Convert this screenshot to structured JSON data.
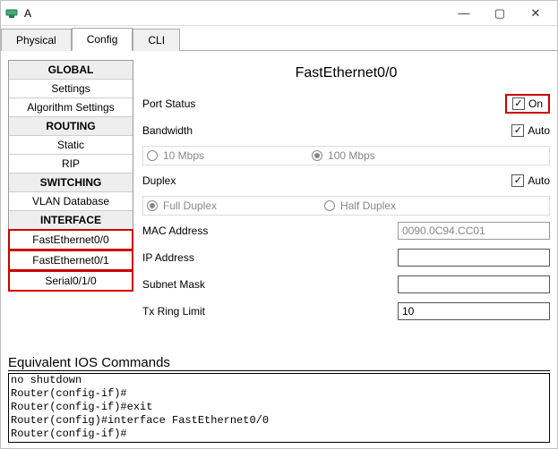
{
  "window": {
    "title": "A"
  },
  "tabs": {
    "physical": "Physical",
    "config": "Config",
    "cli": "CLI"
  },
  "sidebar": {
    "global_hdr": "GLOBAL",
    "settings": "Settings",
    "algo": "Algorithm Settings",
    "routing_hdr": "ROUTING",
    "static": "Static",
    "rip": "RIP",
    "switching_hdr": "SWITCHING",
    "vlan": "VLAN Database",
    "interface_hdr": "INTERFACE",
    "fe00": "FastEthernet0/0",
    "fe01": "FastEthernet0/1",
    "serial": "Serial0/1/0"
  },
  "main": {
    "title": "FastEthernet0/0",
    "port_status_label": "Port Status",
    "on_label": "On",
    "bandwidth_label": "Bandwidth",
    "auto_label": "Auto",
    "bw_10": "10 Mbps",
    "bw_100": "100 Mbps",
    "duplex_label": "Duplex",
    "full_duplex": "Full Duplex",
    "half_duplex": "Half Duplex",
    "mac_label": "MAC Address",
    "mac_value": "0090.0C94.CC01",
    "ip_label": "IP Address",
    "ip_value": "",
    "subnet_label": "Subnet Mask",
    "subnet_value": "",
    "txring_label": "Tx Ring Limit",
    "txring_value": "10"
  },
  "ios": {
    "heading": "Equivalent IOS Commands",
    "line0": "no shutdown",
    "line1": "Router(config-if)#",
    "line2": "Router(config-if)#exit",
    "line3": "Router(config)#interface FastEthernet0/0",
    "line4": "Router(config-if)#"
  }
}
